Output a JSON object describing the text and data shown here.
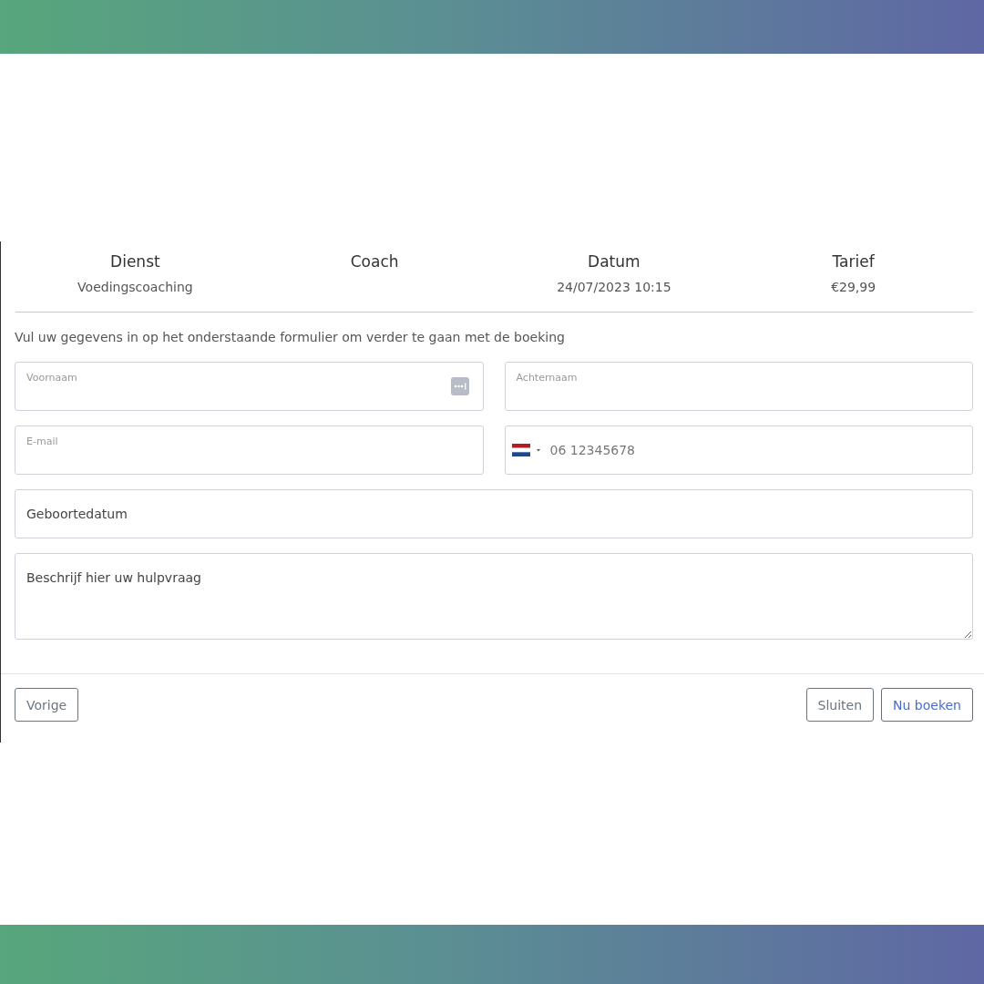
{
  "summary": [
    {
      "heading": "Dienst",
      "value": "Voedingscoaching"
    },
    {
      "heading": "Coach"
    },
    {
      "heading": "Datum",
      "value": "24/07/2023 10:15"
    },
    {
      "heading": "Tarief",
      "value": "€29,99"
    }
  ],
  "intro": "Vul uw gegevens in op het onderstaande formulier om verder te gaan met de boeking",
  "fields": [
    {
      "kind": "floating",
      "label": "Voornaam",
      "autofill_icon": true
    },
    {
      "kind": "floating",
      "label": "Achternaam"
    },
    {
      "kind": "floating",
      "label": "E-mail"
    },
    {
      "kind": "phone",
      "placeholder": "06 12345678"
    },
    {
      "kind": "plain",
      "placeholder": "Geboortedatum"
    },
    {
      "kind": "textarea",
      "placeholder": "Beschrijf hier uw hulpvraag"
    }
  ],
  "footer": {
    "left_buttons": [
      {
        "label": "Vorige"
      }
    ],
    "right_buttons": [
      {
        "label": "Sluiten",
        "kind": "secondary"
      },
      {
        "label": "Nu boeken",
        "kind": "primary"
      }
    ]
  }
}
